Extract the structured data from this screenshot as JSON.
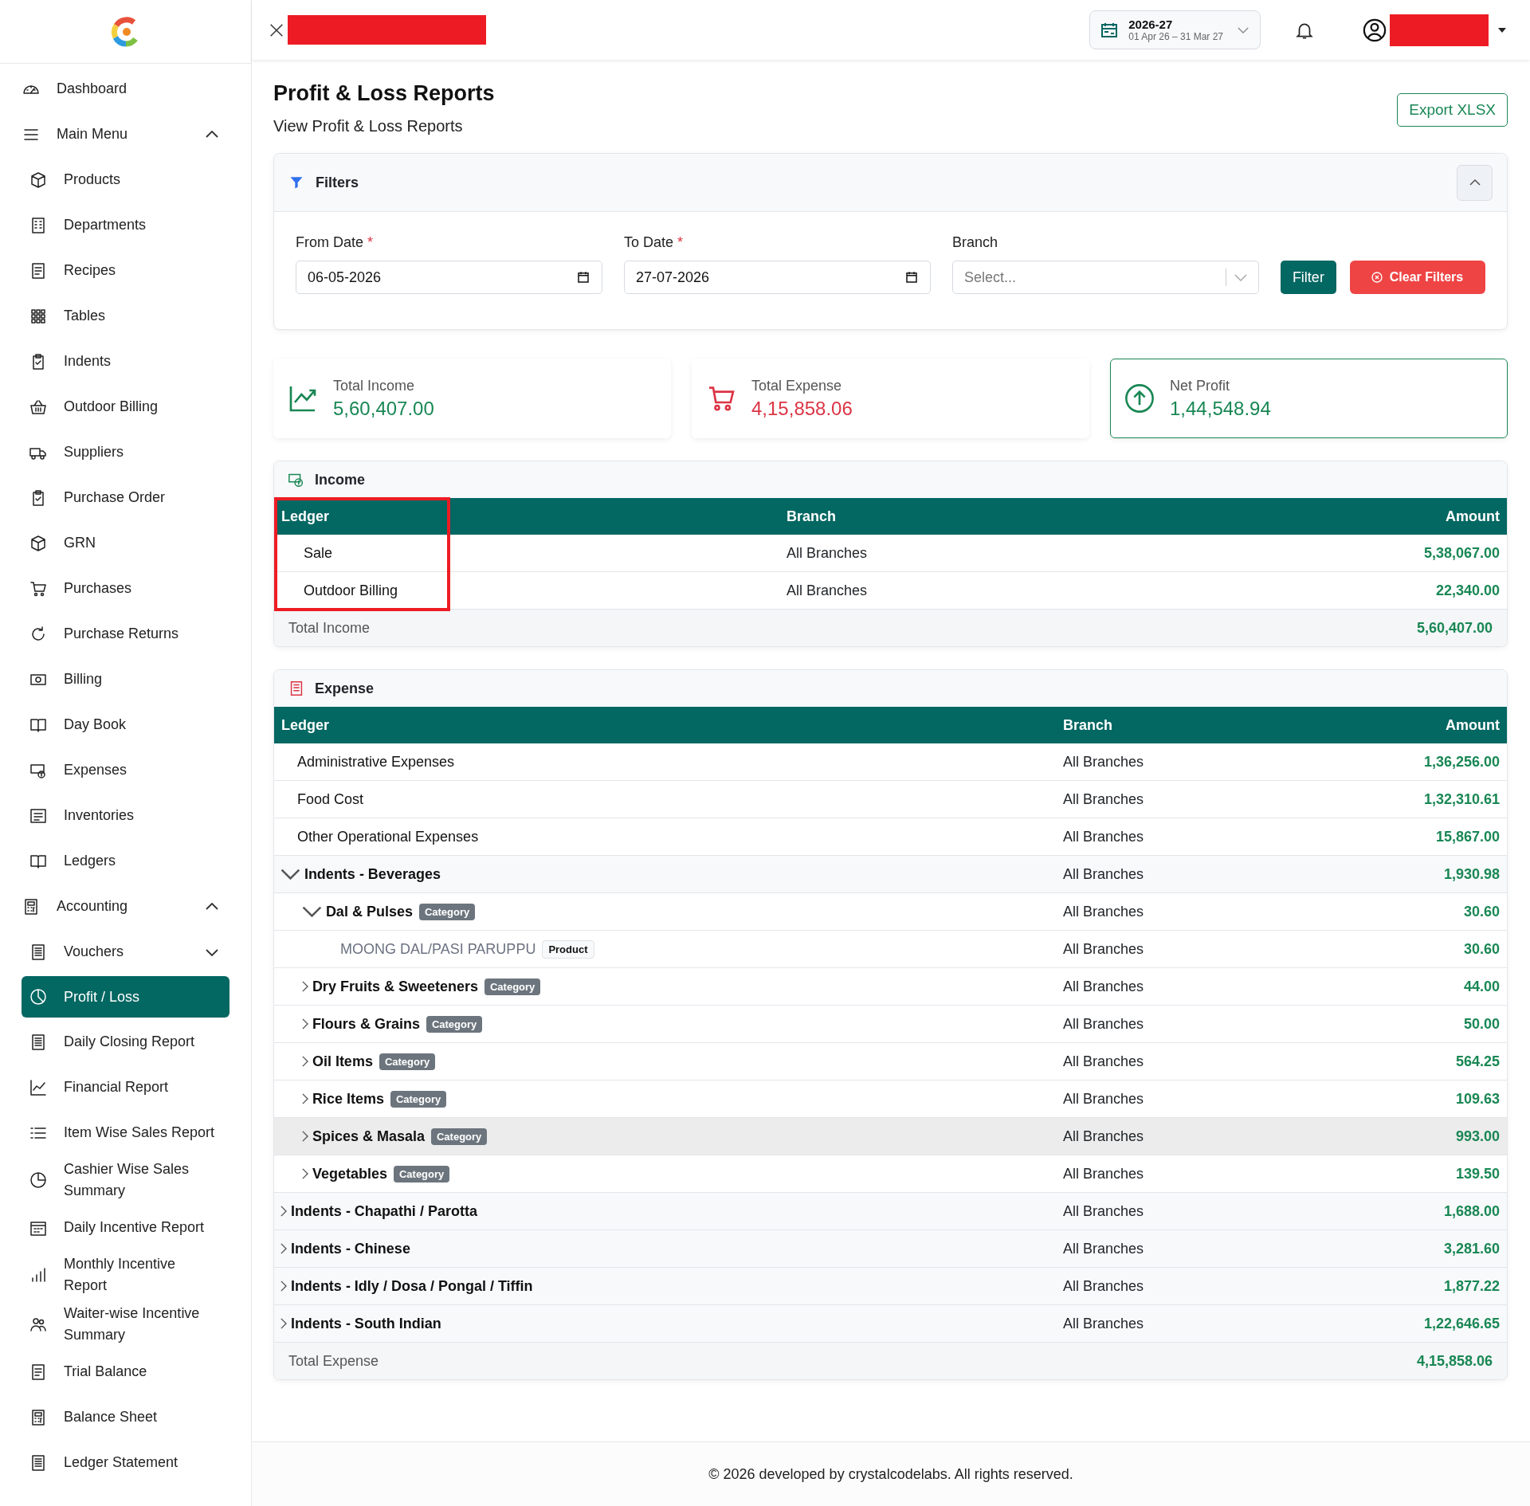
{
  "header": {
    "fiscal_year": {
      "year": "2026-27",
      "range": "01 Apr 26 – 31 Mar 27"
    }
  },
  "sidebar": {
    "items": [
      {
        "label": "Dashboard",
        "selected": false
      },
      {
        "label": "Main Menu",
        "expanded": true,
        "children": [
          {
            "label": "Products",
            "selected": false
          },
          {
            "label": "Departments",
            "selected": false
          },
          {
            "label": "Recipes",
            "selected": false
          },
          {
            "label": "Tables",
            "selected": false
          },
          {
            "label": "Indents",
            "selected": false
          },
          {
            "label": "Outdoor Billing",
            "selected": false
          },
          {
            "label": "Suppliers",
            "selected": false
          },
          {
            "label": "Purchase Order",
            "selected": false
          },
          {
            "label": "GRN",
            "selected": false
          },
          {
            "label": "Purchases",
            "selected": false
          },
          {
            "label": "Purchase Returns",
            "selected": false
          },
          {
            "label": "Billing",
            "selected": false
          },
          {
            "label": "Day Book",
            "selected": false
          },
          {
            "label": "Expenses",
            "selected": false
          },
          {
            "label": "Inventories",
            "selected": false
          },
          {
            "label": "Ledgers",
            "selected": false
          }
        ]
      },
      {
        "label": "Accounting",
        "expanded": true,
        "children": [
          {
            "label": "Vouchers",
            "selected": false,
            "expanded": false
          },
          {
            "label": "Profit / Loss",
            "selected": true
          },
          {
            "label": "Daily Closing Report",
            "selected": false
          },
          {
            "label": "Financial Report",
            "selected": false
          },
          {
            "label": "Item Wise Sales Report",
            "selected": false
          },
          {
            "label": "Cashier Wise Sales Summary",
            "selected": false
          },
          {
            "label": "Daily Incentive Report",
            "selected": false
          },
          {
            "label": "Monthly Incentive Report",
            "selected": false
          },
          {
            "label": "Waiter-wise Incentive Summary",
            "selected": false
          },
          {
            "label": "Trial Balance",
            "selected": false
          },
          {
            "label": "Balance Sheet",
            "selected": false
          },
          {
            "label": "Ledger Statement",
            "selected": false
          }
        ]
      }
    ]
  },
  "page": {
    "title": "Profit & Loss Reports",
    "subtitle": "View Profit & Loss Reports",
    "export_button": "Export XLSX"
  },
  "filters": {
    "title": "Filters",
    "expanded": true,
    "fields": [
      {
        "kind": "date",
        "label": "From Date",
        "required": true,
        "value": "06-05-2026"
      },
      {
        "kind": "date",
        "label": "To Date",
        "required": true,
        "value": "27-07-2026"
      },
      {
        "kind": "select",
        "label": "Branch",
        "required": false,
        "placeholder": "Select..."
      }
    ],
    "required_mark": "*",
    "filter_button": "Filter",
    "clear_button": "Clear Filters"
  },
  "stats": [
    {
      "label": "Total Income",
      "value": "5,60,407.00",
      "color": "#198754",
      "selected": false
    },
    {
      "label": "Total Expense",
      "value": "4,15,858.06",
      "color": "#dc3545",
      "selected": false
    },
    {
      "label": "Net Profit",
      "value": "1,44,548.94",
      "color": "#198754",
      "selected": true
    }
  ],
  "income": {
    "title": "Income",
    "columns": [
      "Ledger",
      "Branch",
      "Amount"
    ],
    "rows": [
      {
        "name": "Sale",
        "branch": "All Branches",
        "amount": "5,38,067.00"
      },
      {
        "name": "Outdoor Billing",
        "branch": "All Branches",
        "amount": "22,340.00"
      }
    ],
    "total": {
      "label": "Total Income",
      "amount": "5,60,407.00"
    }
  },
  "expense": {
    "title": "Expense",
    "columns": [
      "Ledger",
      "Branch",
      "Amount"
    ],
    "rows": [
      {
        "kind": "ledger",
        "name": "Administrative Expenses",
        "branch": "All Branches",
        "amount": "1,36,256.00"
      },
      {
        "kind": "ledger",
        "name": "Food Cost",
        "branch": "All Branches",
        "amount": "1,32,310.61"
      },
      {
        "kind": "ledger",
        "name": "Other Operational Expenses",
        "branch": "All Branches",
        "amount": "15,867.00"
      },
      {
        "kind": "group",
        "name": "Indents - Beverages",
        "branch": "All Branches",
        "amount": "1,930.98",
        "expanded": true,
        "children": [
          {
            "kind": "category",
            "name": "Dal & Pulses",
            "badge": "Category",
            "branch": "All Branches",
            "amount": "30.60",
            "expanded": true,
            "hovered": false,
            "children": [
              {
                "kind": "product",
                "name": "MOONG DAL/PASI PARUPPU",
                "badge": "Product",
                "branch": "All Branches",
                "amount": "30.60"
              }
            ]
          },
          {
            "kind": "category",
            "name": "Dry Fruits & Sweeteners",
            "badge": "Category",
            "branch": "All Branches",
            "amount": "44.00",
            "expanded": false,
            "hovered": false
          },
          {
            "kind": "category",
            "name": "Flours & Grains",
            "badge": "Category",
            "branch": "All Branches",
            "amount": "50.00",
            "expanded": false,
            "hovered": false
          },
          {
            "kind": "category",
            "name": "Oil Items",
            "badge": "Category",
            "branch": "All Branches",
            "amount": "564.25",
            "expanded": false,
            "hovered": false
          },
          {
            "kind": "category",
            "name": "Rice Items",
            "badge": "Category",
            "branch": "All Branches",
            "amount": "109.63",
            "expanded": false,
            "hovered": false
          },
          {
            "kind": "category",
            "name": "Spices & Masala",
            "badge": "Category",
            "branch": "All Branches",
            "amount": "993.00",
            "expanded": false,
            "hovered": true
          },
          {
            "kind": "category",
            "name": "Vegetables",
            "badge": "Category",
            "branch": "All Branches",
            "amount": "139.50",
            "expanded": false,
            "hovered": false
          }
        ]
      },
      {
        "kind": "group",
        "name": "Indents - Chapathi / Parotta",
        "branch": "All Branches",
        "amount": "1,688.00",
        "expanded": false
      },
      {
        "kind": "group",
        "name": "Indents - Chinese",
        "branch": "All Branches",
        "amount": "3,281.60",
        "expanded": false
      },
      {
        "kind": "group",
        "name": "Indents - Idly / Dosa / Pongal / Tiffin",
        "branch": "All Branches",
        "amount": "1,877.22",
        "expanded": false
      },
      {
        "kind": "group",
        "name": "Indents - South Indian",
        "branch": "All Branches",
        "amount": "1,22,646.65",
        "expanded": false
      }
    ],
    "total": {
      "label": "Total Expense",
      "amount": "4,15,858.06"
    }
  },
  "footer": {
    "text": "© 2026 developed by crystalcodelabs. All rights reserved."
  }
}
